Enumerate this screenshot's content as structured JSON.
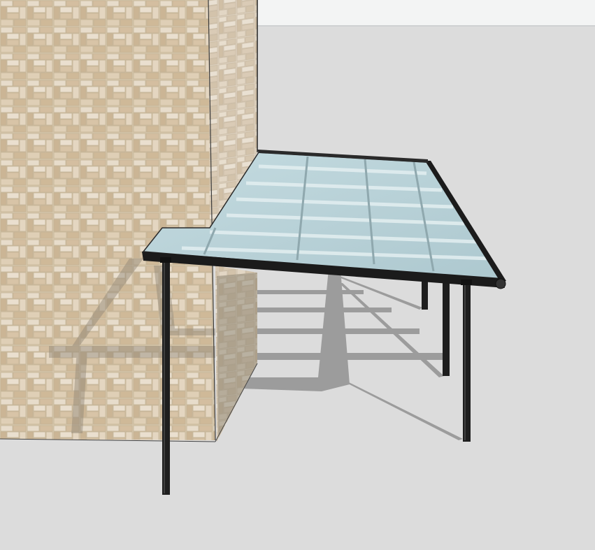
{
  "viewport": {
    "sky_color": "#f3f4f4",
    "ground_color": "#dcdcdc",
    "horizon_color": "#d9dbdc"
  },
  "model": {
    "wall_texture": "beige-stone-pattern",
    "wall_front_color": "#d9cbb3",
    "wall_side_color": "#e0d5c6",
    "roof_glass_color": "#b9d3d9",
    "roof_frame_color": "#171717",
    "post_color": "#1a1a1a",
    "shadow_color": "#9a9a9a"
  }
}
